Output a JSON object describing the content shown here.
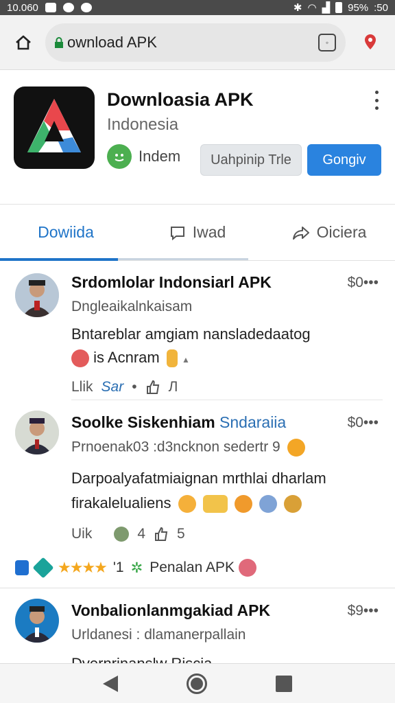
{
  "status_bar": {
    "time_left": "10.060",
    "battery": "95%",
    "clock": ":50"
  },
  "browser": {
    "url": "ownload APK"
  },
  "app": {
    "title": "Downloasia APK",
    "subtitle": "Indonesia",
    "developer": "Indem",
    "secondary_button": "Uahpinip Trle",
    "primary_button": "Gongiv"
  },
  "tabs": [
    {
      "label": "Dowiida",
      "icon": "none"
    },
    {
      "label": "Iwad",
      "icon": "comment-icon"
    },
    {
      "label": "Oiciera",
      "icon": "share-icon"
    }
  ],
  "posts": [
    {
      "title": "Srdomlolar Indonsiarl APK",
      "price": "$0•••",
      "meta": "Dngleaikalnkaisam",
      "body_line1": "Bntareblar amgiam nanslаdedaatog",
      "body_line2": "is Acnram",
      "like_label": "Llik",
      "reaction_label": "Sar",
      "count": "Л"
    },
    {
      "title": "Soolke Siskenhiam",
      "title_highlight": "Sndaraiia",
      "price": "$0•••",
      "meta": "Prnoenak03 :d3ncknon sedertr 9",
      "body_line1": "Darpoalyafatmiaignan mrthlai dharlam",
      "body_line2": "firakalelualiens",
      "like_label": "Uik",
      "reaction_count": "4",
      "count": "5"
    },
    {
      "title": "Vonbalionlanmgakiad APK",
      "price": "$9•••",
      "meta": "Urldanesi :  dlamanerpallain",
      "body_line1": "Dvernrinanslw Riscia"
    }
  ],
  "rating_row": {
    "stars": "★★★★",
    "count": "'1",
    "label": "Penalan APK"
  },
  "colors": {
    "accent": "#2a83df",
    "tab_active": "#1f74c8",
    "star": "#f4a71e"
  }
}
